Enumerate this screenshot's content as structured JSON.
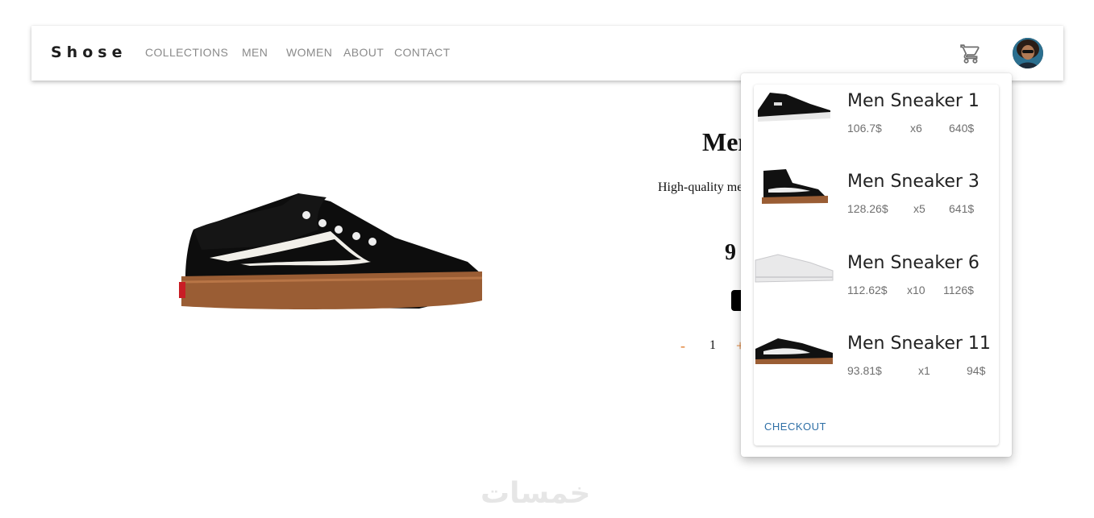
{
  "header": {
    "logo": "Shose",
    "nav": [
      "COLLECTIONS",
      "MEN",
      "WOMEN",
      "ABOUT",
      "CONTACT"
    ],
    "cart_icon": "shopping-cart-icon",
    "avatar_icon": "user-avatar"
  },
  "product": {
    "title_visible": "Men",
    "description_visible": "High-quality me",
    "price_visible": "9",
    "quantity": "1",
    "minus_label": "-",
    "plus_label": "+"
  },
  "cart": {
    "items": [
      {
        "name": "Men Sneaker 1",
        "price": "106.7$",
        "qty": "x6",
        "total": "640$"
      },
      {
        "name": "Men Sneaker 3",
        "price": "128.26$",
        "qty": "x5",
        "total": "641$"
      },
      {
        "name": "Men Sneaker 6",
        "price": "112.62$",
        "qty": "x10",
        "total": "1126$"
      },
      {
        "name": "Men Sneaker 11",
        "price": "93.81$",
        "qty": "x1",
        "total": "94$"
      }
    ],
    "checkout_label": "CHECKOUT"
  },
  "watermark": "خمسات",
  "colors": {
    "accent_orange": "#e07b2a",
    "checkout_blue": "#2e6fa6",
    "nav_gray": "#8a8a8a"
  }
}
